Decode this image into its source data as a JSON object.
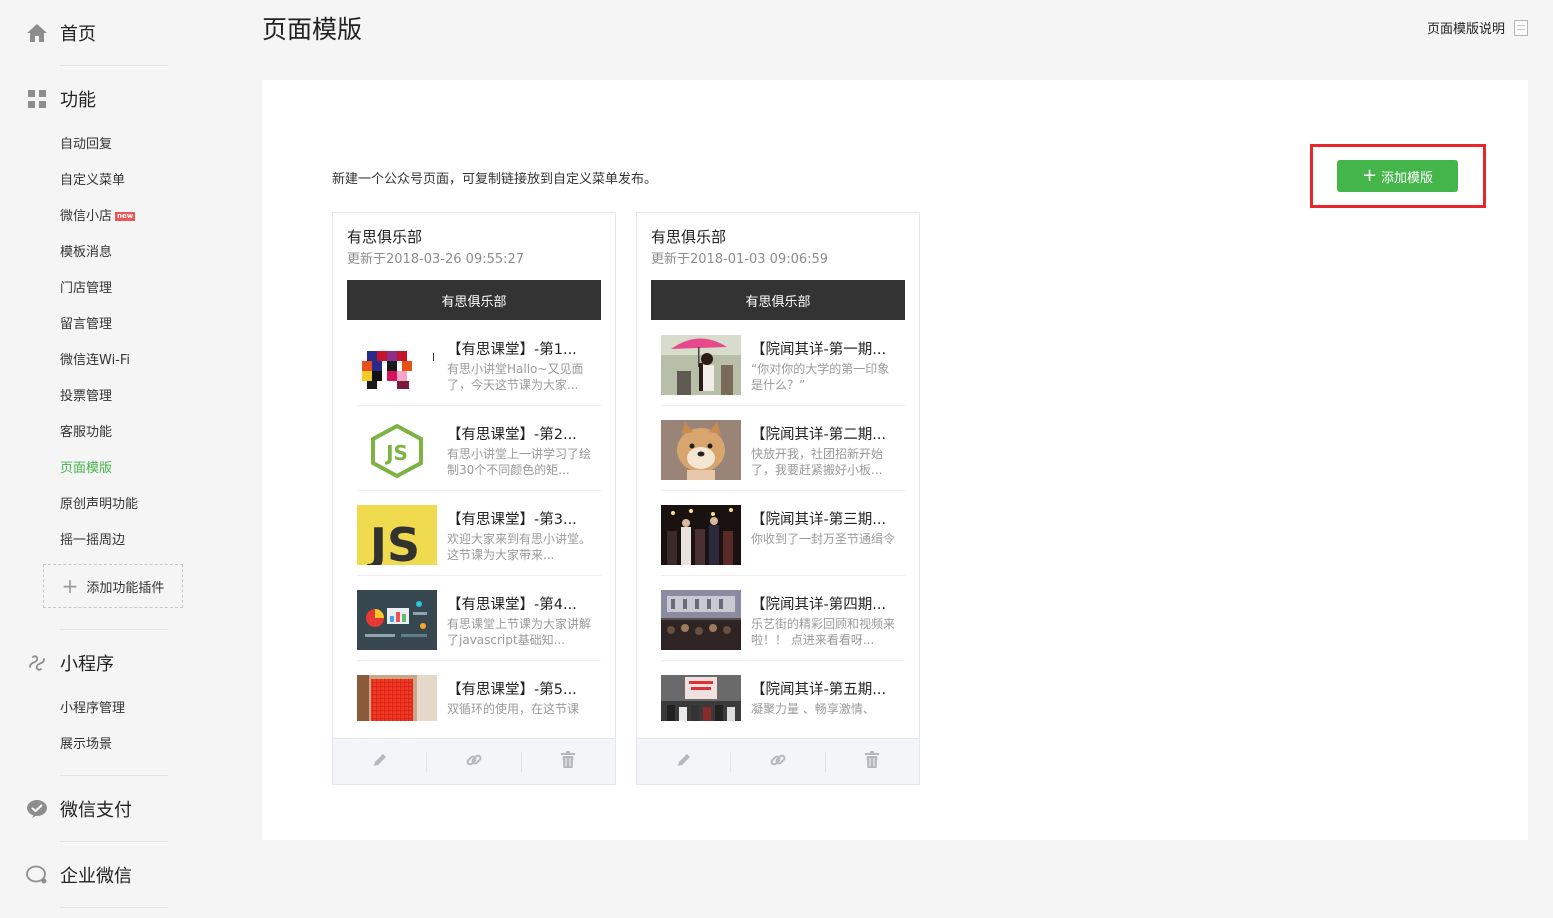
{
  "sidebar": {
    "home": "首页",
    "functions": {
      "title": "功能",
      "items": [
        "自动回复",
        "自定义菜单",
        "微信小店",
        "模板消息",
        "门店管理",
        "留言管理",
        "微信连Wi-Fi",
        "投票管理",
        "客服功能",
        "页面模版",
        "原创声明功能",
        "摇一摇周边"
      ],
      "new_badge": "new",
      "active_item": "页面模版",
      "add_plugin": "添加功能插件"
    },
    "miniprogram": {
      "title": "小程序",
      "items": [
        "小程序管理",
        "展示场景"
      ]
    },
    "pay": "微信支付",
    "wework": "企业微信"
  },
  "header": {
    "title": "页面模版",
    "help_link": "页面模版说明"
  },
  "main": {
    "intro": "新建一个公众号页面，可复制链接放到自定义菜单发布。",
    "add_button": "添加模版",
    "accent_color": "#44b549",
    "highlight_color": "#e8262e",
    "cards": [
      {
        "title": "有思俱乐部",
        "updated": "更新于2018-03-26 09:55:27",
        "header_bar": "有思俱乐部",
        "articles": [
          {
            "title": "【有思课堂】-第1...",
            "desc": "有思小讲堂Hallo~又见面了，今天这节课为大家...",
            "thumb": "pixel-blocks-thumbnail"
          },
          {
            "title": "【有思课堂】-第2...",
            "desc": "有思小讲堂上一讲学习了绘制30个不同颜色的矩...",
            "thumb": "nodejs-logo-thumbnail"
          },
          {
            "title": "【有思课堂】-第3...",
            "desc": "欢迎大家来到有思小讲堂。这节课为大家带来...",
            "thumb": "js-logo-thumbnail"
          },
          {
            "title": "【有思课堂】-第4...",
            "desc": "有思课堂上节课为大家讲解了javascript基础知...",
            "thumb": "charts-thumbnail"
          },
          {
            "title": "【有思课堂】-第5...",
            "desc": "双循环的使用，在这节课",
            "thumb": "red-grid-thumbnail"
          }
        ]
      },
      {
        "title": "有思俱乐部",
        "updated": "更新于2018-01-03 09:06:59",
        "header_bar": "有思俱乐部",
        "articles": [
          {
            "title": "【院闻其详-第一期...",
            "desc": "“你对你的大学的第一印象是什么？”",
            "thumb": "girl-umbrella-photo"
          },
          {
            "title": "【院闻其详-第二期...",
            "desc": "快放开我，社团招新开始了，我要赶紧搬好小板...",
            "thumb": "shiba-dog-photo"
          },
          {
            "title": "【院闻其详-第三期...",
            "desc": "你收到了一封万圣节通缉令",
            "thumb": "halloween-party-photo"
          },
          {
            "title": "【院闻其详-第四期...",
            "desc": "乐艺街的精彩回顾和视频来啦！！ 点进来看看呀...",
            "thumb": "stage-crowd-photo"
          },
          {
            "title": "【院闻其详-第五期...",
            "desc": "凝聚力量 、畅享激情、",
            "thumb": "group-banner-photo"
          }
        ]
      }
    ]
  }
}
